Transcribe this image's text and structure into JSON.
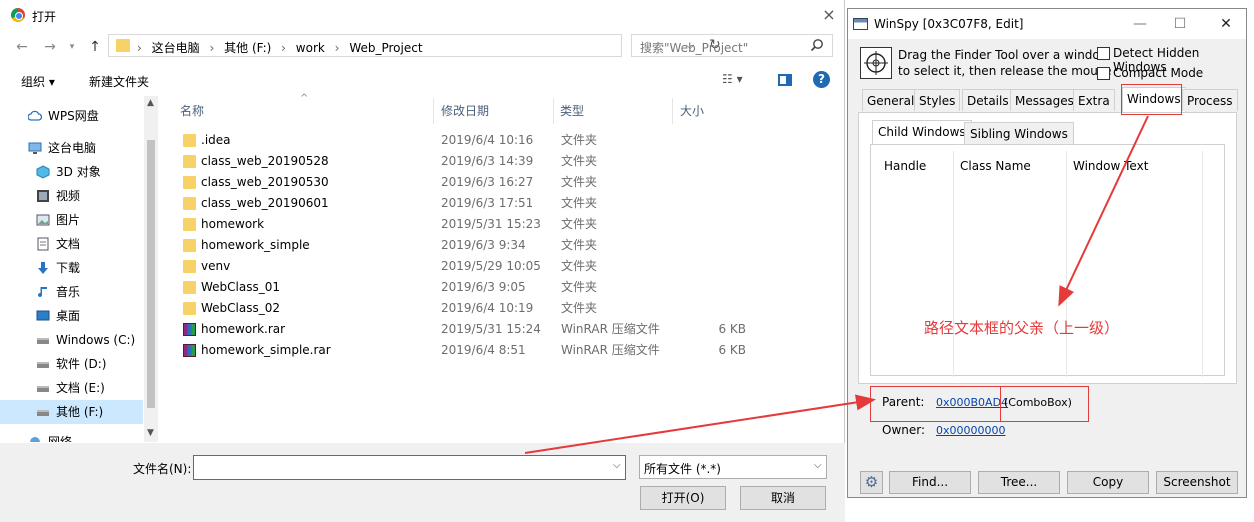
{
  "dialog": {
    "title": "打开",
    "close": "×",
    "nav": {
      "back": "←",
      "forward": "→",
      "up": "↑"
    },
    "breadcrumbs": [
      "这台电脑",
      "其他 (F:)",
      "work",
      "Web_Project"
    ],
    "crumb_separator": "›",
    "search_placeholder": "搜索\"Web_Project\"",
    "toolbar": {
      "organize": "组织 ▾",
      "new_folder": "新建文件夹",
      "help": "?"
    },
    "sidebar": [
      {
        "label": "WPS网盘",
        "icon": "cloud-icon"
      },
      {
        "label": "这台电脑",
        "icon": "computer-icon"
      },
      {
        "label": "3D 对象",
        "icon": "cube-icon"
      },
      {
        "label": "视频",
        "icon": "video-icon"
      },
      {
        "label": "图片",
        "icon": "picture-icon"
      },
      {
        "label": "文档",
        "icon": "document-icon"
      },
      {
        "label": "下载",
        "icon": "download-icon"
      },
      {
        "label": "音乐",
        "icon": "music-icon"
      },
      {
        "label": "桌面",
        "icon": "desktop-icon"
      },
      {
        "label": "Windows (C:)",
        "icon": "drive-icon"
      },
      {
        "label": "软件 (D:)",
        "icon": "drive-icon"
      },
      {
        "label": "文档 (E:)",
        "icon": "drive-icon"
      },
      {
        "label": "其他 (F:)",
        "icon": "drive-icon",
        "selected": true
      },
      {
        "label": "网络",
        "icon": "network-icon"
      }
    ],
    "columns": {
      "name": "名称",
      "date": "修改日期",
      "type": "类型",
      "size": "大小"
    },
    "files": [
      {
        "name": ".idea",
        "date": "2019/6/4 10:16",
        "type": "文件夹",
        "size": "",
        "kind": "folder"
      },
      {
        "name": "class_web_20190528",
        "date": "2019/6/3 14:39",
        "type": "文件夹",
        "size": "",
        "kind": "folder"
      },
      {
        "name": "class_web_20190530",
        "date": "2019/6/3 16:27",
        "type": "文件夹",
        "size": "",
        "kind": "folder"
      },
      {
        "name": "class_web_20190601",
        "date": "2019/6/3 17:51",
        "type": "文件夹",
        "size": "",
        "kind": "folder"
      },
      {
        "name": "homework",
        "date": "2019/5/31 15:23",
        "type": "文件夹",
        "size": "",
        "kind": "folder"
      },
      {
        "name": "homework_simple",
        "date": "2019/6/3 9:34",
        "type": "文件夹",
        "size": "",
        "kind": "folder"
      },
      {
        "name": "venv",
        "date": "2019/5/29 10:05",
        "type": "文件夹",
        "size": "",
        "kind": "folder"
      },
      {
        "name": "WebClass_01",
        "date": "2019/6/3 9:05",
        "type": "文件夹",
        "size": "",
        "kind": "folder"
      },
      {
        "name": "WebClass_02",
        "date": "2019/6/4 10:19",
        "type": "文件夹",
        "size": "",
        "kind": "folder"
      },
      {
        "name": "homework.rar",
        "date": "2019/5/31 15:24",
        "type": "WinRAR 压缩文件",
        "size": "6 KB",
        "kind": "rar"
      },
      {
        "name": "homework_simple.rar",
        "date": "2019/6/4 8:51",
        "type": "WinRAR 压缩文件",
        "size": "6 KB",
        "kind": "rar"
      }
    ],
    "filename_label": "文件名(N):",
    "filename_value": "",
    "filter_value": "所有文件 (*.*)",
    "open_button": "打开(O)",
    "cancel_button": "取消"
  },
  "winspy": {
    "title": "WinSpy [0x3C07F8, Edit]",
    "finder_text_1": "Drag the Finder Tool over a window",
    "finder_text_2": "to select it, then release the mouse",
    "detect_hidden": "Detect Hidden Windows",
    "compact_mode": "Compact Mode",
    "tabs": [
      "General",
      "Styles",
      "Details",
      "Messages",
      "Extra",
      "Windows",
      "Process"
    ],
    "active_tab": "Windows",
    "subtabs": [
      "Child Windows",
      "Sibling Windows"
    ],
    "list_columns": [
      "Handle",
      "Class Name",
      "Window Text"
    ],
    "parent_label": "Parent:",
    "parent_handle": "0x000B0AD4",
    "parent_class": "(ComboBox)",
    "owner_label": "Owner:",
    "owner_handle": "0x00000000",
    "buttons": {
      "find": "Find...",
      "tree": "Tree...",
      "copy": "Copy",
      "screenshot": "Screenshot"
    }
  },
  "annotation": {
    "note": "路径文本框的父亲（上一级）",
    "color": "#e53a3a"
  }
}
